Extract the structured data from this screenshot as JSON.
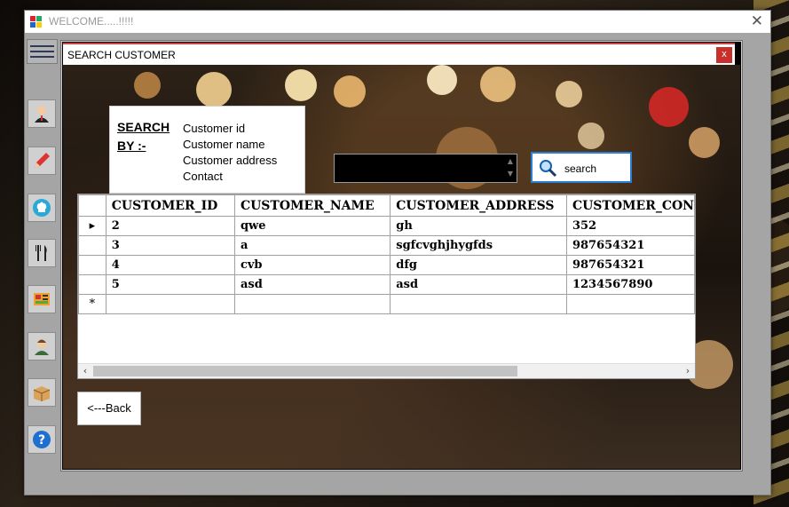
{
  "window": {
    "title": "WELCOME.....!!!!!",
    "close_glyph": "✕"
  },
  "dialog": {
    "title": "SEARCH CUSTOMER",
    "close_glyph": "x"
  },
  "sidebar": {
    "items": [
      {
        "icon": "customer-icon"
      },
      {
        "icon": "pencil-icon"
      },
      {
        "icon": "chef-hat-icon"
      },
      {
        "icon": "fork-knife-icon"
      },
      {
        "icon": "menu-card-icon"
      },
      {
        "icon": "staff-icon"
      },
      {
        "icon": "box-icon"
      },
      {
        "icon": "help-icon"
      }
    ]
  },
  "search": {
    "by_label_1": "SEARCH",
    "by_label_2": "BY :-",
    "options": [
      "Customer id",
      "Customer name",
      "Customer address",
      "Contact"
    ],
    "input_value": "",
    "button_label": "search"
  },
  "grid": {
    "columns": [
      "CUSTOMER_ID",
      "CUSTOMER_NAME",
      "CUSTOMER_ADDRESS",
      "CUSTOMER_CON"
    ],
    "rows": [
      [
        "2",
        "qwe",
        "gh",
        "352"
      ],
      [
        "3",
        "a",
        "sgfcvghjhygfds",
        "987654321"
      ],
      [
        "4",
        "cvb",
        "dfg",
        "987654321"
      ],
      [
        "5",
        "asd",
        "asd",
        "1234567890"
      ]
    ],
    "current_row_marker": "▸",
    "new_row_marker": "*"
  },
  "back_button": {
    "label": "<---Back"
  }
}
